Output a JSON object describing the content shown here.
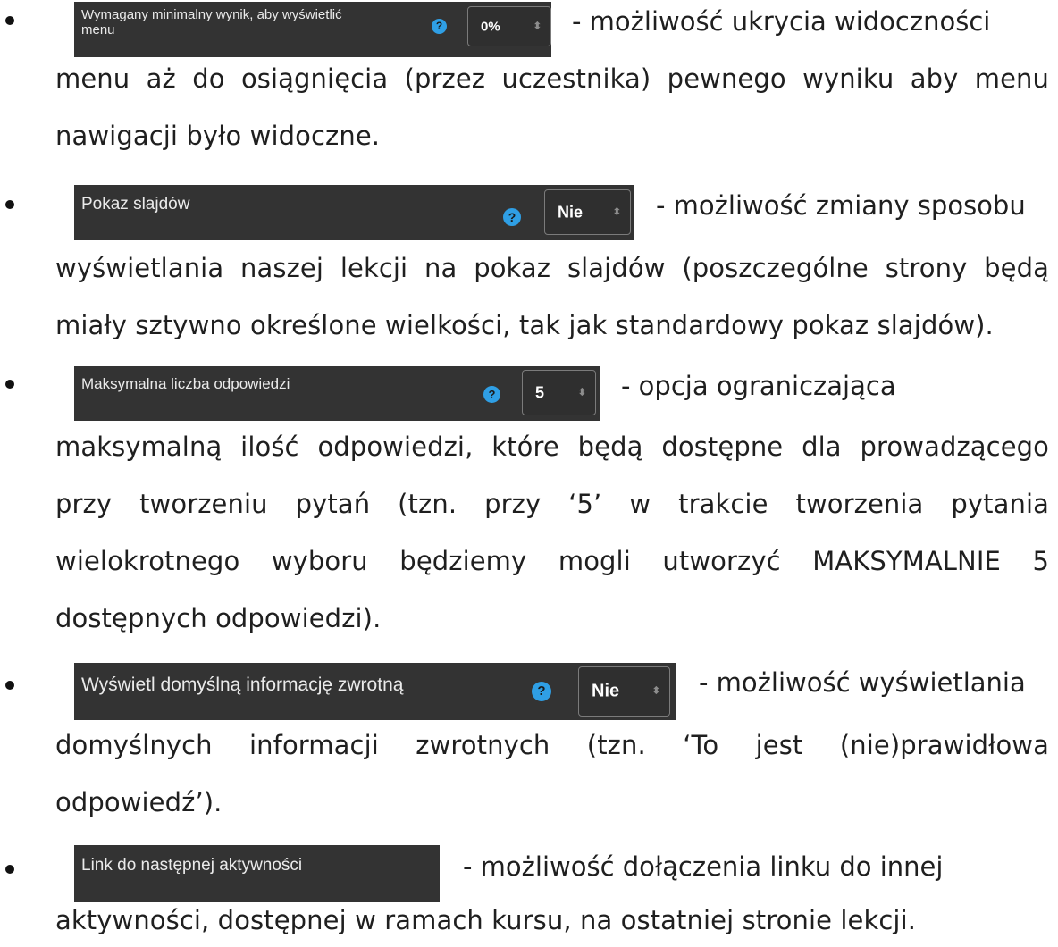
{
  "items": [
    {
      "ui": {
        "label": "Wymagany minimalny wynik, aby wyświetlić menu",
        "help_icon": "question-circle-icon",
        "value": "0%",
        "arrow": "sort-arrows-icon"
      },
      "first_line": "- możliwość ukrycia widoczności",
      "lines": [
        "menu aż do osiągnięcia (przez uczestnika) pewnego wyniku aby menu",
        "nawigacji było widoczne."
      ]
    },
    {
      "ui": {
        "label": "Pokaz slajdów",
        "help_icon": "question-circle-icon",
        "value": "Nie",
        "arrow": "sort-arrows-icon"
      },
      "first_line": "- możliwość zmiany sposobu",
      "lines": [
        "wyświetlania naszej lekcji na pokaz slajdów (poszczególne strony będą",
        "miały sztywno określone wielkości, tak jak standardowy pokaz slajdów)."
      ]
    },
    {
      "ui": {
        "label": "Maksymalna liczba odpowiedzi",
        "help_icon": "question-circle-icon",
        "value": "5",
        "arrow": "sort-arrows-icon"
      },
      "first_line": "- opcja ograniczająca",
      "lines": [
        "maksymalną ilość odpowiedzi, które będą dostępne dla prowadzącego",
        "przy tworzeniu pytań (tzn. przy ‘5’ w trakcie tworzenia pytania",
        "wielokrotnego wyboru będziemy mogli utworzyć MAKSYMALNIE 5",
        "dostępnych odpowiedzi)."
      ]
    },
    {
      "ui": {
        "label": "Wyświetl domyślną informację zwrotną",
        "help_icon": "question-circle-icon",
        "value": "Nie",
        "arrow": "sort-arrows-icon"
      },
      "first_line": "- możliwość wyświetlania",
      "lines": [
        "domyślnych informacji zwrotnych (tzn. ‘To jest (nie)prawidłowa",
        "odpowiedź’)."
      ]
    },
    {
      "ui": {
        "label": "Link do następnej aktywności"
      },
      "first_line": "- możliwość dołączenia linku do innej",
      "lines": [
        "aktywności, dostępnej w ramach kursu, na ostatniej stronie lekcji."
      ]
    }
  ]
}
